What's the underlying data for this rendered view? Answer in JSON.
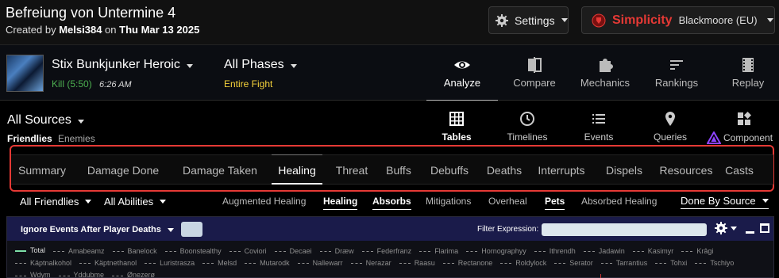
{
  "report": {
    "title": "Befreiung von Untermine 4",
    "created_by_prefix": "Created by",
    "author": "Melsi384",
    "date_prefix": "on",
    "date": "Thu Mar 13 2025"
  },
  "header_buttons": {
    "settings_label": "Settings",
    "guild_name": "Simplicity",
    "guild_realm": "Blackmoore (EU)",
    "guild_color": "#e53935"
  },
  "fight": {
    "boss_name": "Stix Bunkjunker Heroic",
    "kill_label": "Kill (5:50)",
    "kill_time": "6:26 AM",
    "phase": "All Phases",
    "phase_sub": "Entire Fight"
  },
  "main_nav": [
    {
      "label": "Analyze",
      "icon": "eye-icon",
      "active": true
    },
    {
      "label": "Compare",
      "icon": "compare-icon",
      "active": false
    },
    {
      "label": "Mechanics",
      "icon": "puzzle-icon",
      "active": false
    },
    {
      "label": "Rankings",
      "icon": "bars-icon",
      "active": false
    },
    {
      "label": "Replay",
      "icon": "film-icon",
      "active": false
    }
  ],
  "source": {
    "label": "All Sources",
    "friendlies": "Friendlies",
    "enemies": "Enemies"
  },
  "views": [
    {
      "label": "Tables",
      "icon": "grid-icon",
      "active": true
    },
    {
      "label": "Timelines",
      "icon": "clock-icon",
      "active": false
    },
    {
      "label": "Events",
      "icon": "list-icon",
      "active": false
    },
    {
      "label": "Queries",
      "icon": "pin-icon",
      "active": false
    },
    {
      "label": "Component",
      "icon": "shapes-icon",
      "active": false
    }
  ],
  "tabs": [
    {
      "label": "Summary",
      "active": false
    },
    {
      "label": "Damage Done",
      "active": false
    },
    {
      "label": "Damage Taken",
      "active": false
    },
    {
      "label": "Healing",
      "active": true
    },
    {
      "label": "Threat",
      "active": false
    },
    {
      "label": "Buffs",
      "active": false
    },
    {
      "label": "Debuffs",
      "active": false
    },
    {
      "label": "Deaths",
      "active": false
    },
    {
      "label": "Interrupts",
      "active": false
    },
    {
      "label": "Dispels",
      "active": false
    },
    {
      "label": "Resources",
      "active": false
    },
    {
      "label": "Casts",
      "active": false
    }
  ],
  "filters": {
    "friendlies_dd": "All Friendlies",
    "abilities_dd": "All Abilities",
    "sub_tabs": [
      {
        "label": "Augmented Healing",
        "active": false
      },
      {
        "label": "Healing",
        "active": true
      },
      {
        "label": "Absorbs",
        "active": true
      },
      {
        "label": "Mitigations",
        "active": false
      },
      {
        "label": "Overheal",
        "active": false
      },
      {
        "label": "Pets",
        "active": true
      },
      {
        "label": "Absorbed Healing",
        "active": false
      }
    ],
    "done_by": "Done By Source"
  },
  "graph": {
    "ignore_label": "Ignore Events After Player Deaths",
    "filter_expression_label": "Filter Expression:",
    "filter_expression_value": "",
    "legend": [
      "Total",
      "Amabeamz",
      "Banelock",
      "Boonstealthy",
      "Coviori",
      "Decaei",
      "Dræw",
      "Federfranz",
      "Flarima",
      "Hornographyy",
      "Ithrendh",
      "Jadawin",
      "Kasimyr",
      "Krâgi",
      "Käptnalkohol",
      "Käptnethanol",
      "Luristrasza",
      "Melsd",
      "Mutarodk",
      "Nallewarr",
      "Nerazar",
      "Raasu",
      "Rectanone",
      "Roldylock",
      "Serator",
      "Tarrantius",
      "Tohxi",
      "Tschiyo",
      "Wdym",
      "Yddubme",
      "Ønezerø"
    ]
  }
}
